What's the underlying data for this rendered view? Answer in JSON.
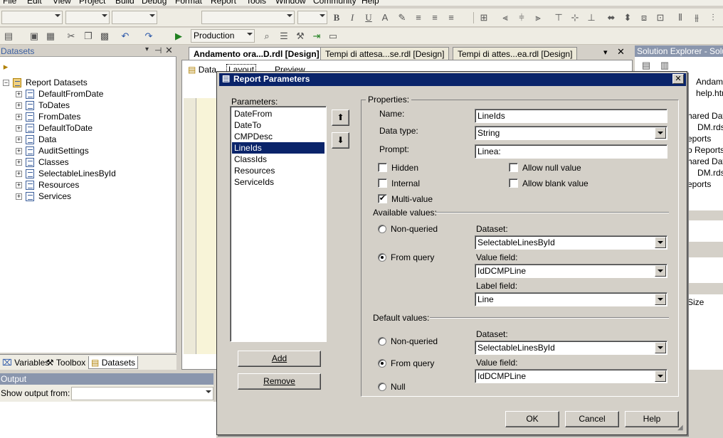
{
  "menu": [
    "File",
    "Edit",
    "View",
    "Project",
    "Build",
    "Debug",
    "Format",
    "Tools",
    "Report",
    "Window",
    "Community",
    "Help"
  ],
  "toolbar": {
    "config_combo": "Production"
  },
  "datasets_panel": {
    "title": "Datasets",
    "root": "Report Datasets",
    "items": [
      "DefaultFromDate",
      "ToDates",
      "FromDates",
      "DefaultToDate",
      "Data",
      "AuditSettings",
      "Classes",
      "SelectableLinesById",
      "Resources",
      "Services"
    ]
  },
  "bottom_tabs": [
    "Variables",
    "Toolbox",
    "Datasets"
  ],
  "output": {
    "title": "Output",
    "show_label": "Show output from:"
  },
  "doc_tabs": [
    "Andamento ora...D.rdl [Design]",
    "Tempi di attesa...se.rdl [Design]",
    "Tempi di attes...ea.rdl [Design]"
  ],
  "designer_tabs": [
    "Data",
    "Layout",
    "Preview"
  ],
  "solution_explorer": {
    "title": "Solution Explorer - Solution",
    "items": [
      "Andame",
      "help.htm",
      "hared Dat",
      "DM.rds",
      "eports",
      "o Reports",
      "hared Dat",
      "DM.rds",
      "eports"
    ],
    "size_label": "Size"
  },
  "dialog": {
    "title": "Report Parameters",
    "parameters_label": "Parameters:",
    "parameters": [
      "DateFrom",
      "DateTo",
      "CMPDesc",
      "LineIds",
      "ClassIds",
      "Resources",
      "ServiceIds"
    ],
    "selected_parameter": "LineIds",
    "add_button": "Add",
    "remove_button": "Remove",
    "properties_label": "Properties:",
    "name_label": "Name:",
    "name_value": "LineIds",
    "datatype_label": "Data type:",
    "datatype_value": "String",
    "prompt_label": "Prompt:",
    "prompt_value": "Linea:",
    "hidden_label": "Hidden",
    "internal_label": "Internal",
    "multivalue_label": "Multi-value",
    "allow_null_label": "Allow null value",
    "allow_blank_label": "Allow blank value",
    "available_label": "Available values:",
    "nonqueried_label": "Non-queried",
    "fromquery_label": "From query",
    "dataset_label": "Dataset:",
    "available_dataset": "SelectableLinesById",
    "value_field_label": "Value field:",
    "available_value_field": "IdDCMPLine",
    "label_field_label": "Label field:",
    "available_label_field": "Line",
    "default_label": "Default values:",
    "null_label": "Null",
    "default_dataset": "SelectableLinesById",
    "default_value_field": "IdDCMPLine",
    "ok_button": "OK",
    "cancel_button": "Cancel",
    "help_button": "Help"
  }
}
